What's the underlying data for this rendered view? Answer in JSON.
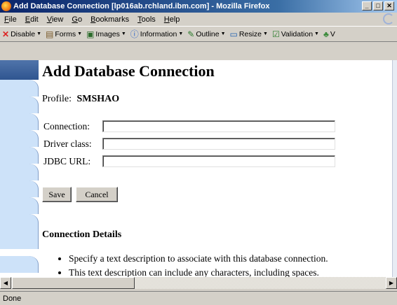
{
  "window": {
    "title": "Add Database Connection [lp016ab.rchland.ibm.com] - Mozilla Firefox",
    "controls": {
      "minimize": "_",
      "maximize": "□",
      "close": "✕"
    }
  },
  "menu": {
    "items": [
      {
        "label": "File"
      },
      {
        "label": "Edit"
      },
      {
        "label": "View"
      },
      {
        "label": "Go"
      },
      {
        "label": "Bookmarks"
      },
      {
        "label": "Tools"
      },
      {
        "label": "Help"
      }
    ]
  },
  "devbar": {
    "items": [
      {
        "label": "Disable",
        "icon": "✕",
        "icon_name": "disable-icon"
      },
      {
        "label": "Forms",
        "icon": "▤",
        "icon_name": "forms-icon"
      },
      {
        "label": "Images",
        "icon": "▣",
        "icon_name": "images-icon"
      },
      {
        "label": "Information",
        "icon": "ⓘ",
        "icon_name": "information-icon"
      },
      {
        "label": "Outline",
        "icon": "✎",
        "icon_name": "outline-icon"
      },
      {
        "label": "Resize",
        "icon": "▭",
        "icon_name": "resize-icon"
      },
      {
        "label": "Validation",
        "icon": "☑",
        "icon_name": "validation-icon"
      },
      {
        "label": "V",
        "icon": "♣",
        "icon_name": "view-source-icon"
      }
    ],
    "caret": "▼"
  },
  "page": {
    "title": "Add Database Connection",
    "profile_label": "Profile:",
    "profile_value": "SMSHAO",
    "fields": {
      "connection": {
        "label": "Connection:",
        "value": ""
      },
      "driver_class": {
        "label": "Driver class:",
        "value": ""
      },
      "jdbc_url": {
        "label": "JDBC URL:",
        "value": ""
      }
    },
    "buttons": {
      "save": "Save",
      "cancel": "Cancel"
    },
    "details_title": "Connection Details",
    "details": [
      "Specify a text description to associate with this database connection.",
      "This text description can include any characters, including spaces."
    ]
  },
  "scrollbar": {
    "left_arrow": "◀",
    "right_arrow": "▶"
  },
  "status": {
    "text": "Done"
  },
  "colors": {
    "titlebar_start": "#0a246a",
    "titlebar_end": "#a6caf0",
    "chrome": "#d4d0c8",
    "sidebar_tab": "#cde2f9",
    "sidebar_head": "#2f5590"
  }
}
